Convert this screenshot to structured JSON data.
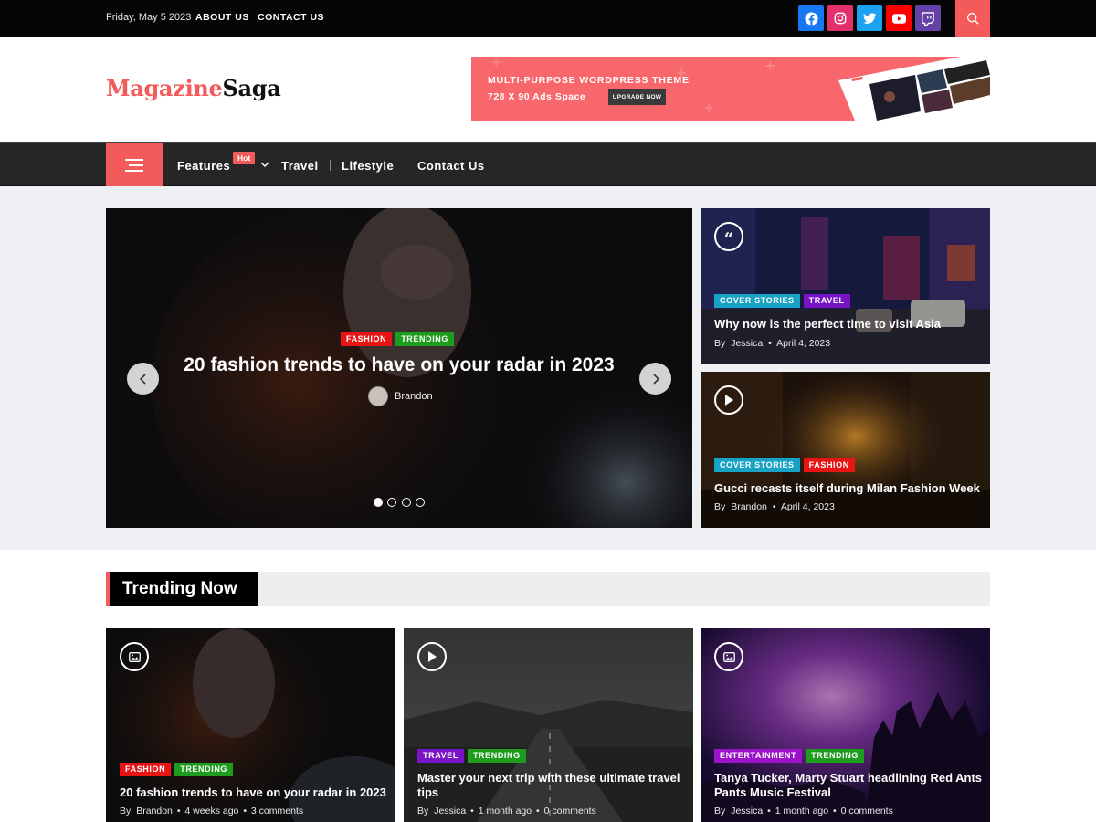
{
  "topbar": {
    "date": "Friday, May 5 2023",
    "links": [
      "ABOUT US",
      "CONTACT US"
    ],
    "social": [
      {
        "name": "facebook-icon",
        "color": "#1877f2"
      },
      {
        "name": "instagram-icon",
        "color": "#e1306c"
      },
      {
        "name": "twitter-icon",
        "color": "#1da1f2"
      },
      {
        "name": "youtube-icon",
        "color": "#ff0000"
      },
      {
        "name": "twitch-icon",
        "color": "#6441a5"
      }
    ]
  },
  "header": {
    "logo_part1": "Magazine",
    "logo_part2": "Saga",
    "ad": {
      "line1": "MULTI-PURPOSE WORDPRESS THEME",
      "line2": "728 X 90 Ads Space",
      "button": "UPGRADE NOW"
    }
  },
  "nav": {
    "items": [
      "Features",
      "Travel",
      "Lifestyle",
      "Contact Us"
    ],
    "hot_badge": "Hot"
  },
  "slider": {
    "tags": [
      "FASHION",
      "TRENDING"
    ],
    "title": "20 fashion trends to have on your radar in 2023",
    "author": "Brandon",
    "slide_count": 4,
    "active_slide": 1
  },
  "side_posts": [
    {
      "tags": [
        "COVER STORIES",
        "TRAVEL"
      ],
      "title": "Why now is the perfect time to visit Asia",
      "by": "By",
      "author": "Jessica",
      "date": "April 4, 2023",
      "icon": "quote-icon"
    },
    {
      "tags": [
        "COVER STORIES",
        "FASHION"
      ],
      "title": "Gucci recasts itself during Milan Fashion Week",
      "by": "By",
      "author": "Brandon",
      "date": "April 4, 2023",
      "icon": "play-icon"
    }
  ],
  "trending": {
    "heading": "Trending Now",
    "posts": [
      {
        "tags": [
          "FASHION",
          "TRENDING"
        ],
        "title": "20 fashion trends to have on your radar in 2023",
        "by": "By",
        "author": "Brandon",
        "time": "4 weeks ago",
        "comments": "3 comments",
        "icon": "image-icon"
      },
      {
        "tags": [
          "TRAVEL",
          "TRENDING"
        ],
        "title": "Master your next trip with these ultimate travel tips",
        "by": "By",
        "author": "Jessica",
        "time": "1 month ago",
        "comments": "0 comments",
        "icon": "play-icon"
      },
      {
        "tags": [
          "ENTERTAINMENT",
          "TRENDING"
        ],
        "title": "Tanya Tucker, Marty Stuart headlining Red Ants Pants Music Festival",
        "by": "By",
        "author": "Jessica",
        "time": "1 month ago",
        "comments": "0 comments",
        "icon": "gallery-icon"
      }
    ]
  },
  "colors": {
    "accent": "#f35a5a",
    "fashion": "#e81414",
    "trending": "#1d9c1d",
    "cover_stories": "#18a2c4",
    "travel": "#7813c8",
    "entertainment": "#9c12c9"
  }
}
